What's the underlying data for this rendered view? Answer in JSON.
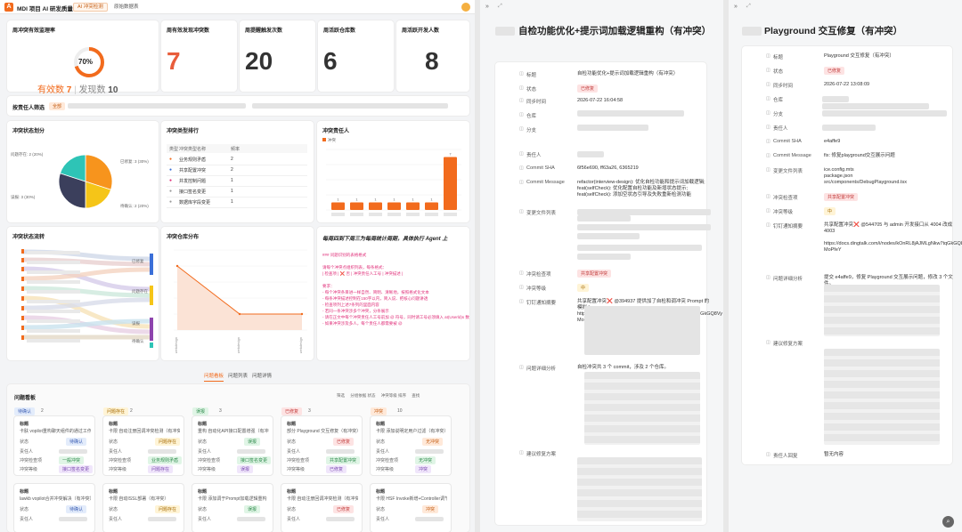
{
  "app": {
    "title": "MDI 项目 AI 研发质量",
    "tab_active": "AI 冲突检测",
    "tab_other": "原始数据表"
  },
  "kpis": [
    {
      "label": "周冲突有效监理率",
      "gauge": "70%",
      "valid_label": "有效数",
      "valid": "7",
      "found_label": "发现数",
      "found": "10",
      "rate": 0.7
    },
    {
      "label": "周有效发现冲突数",
      "value": "7",
      "color": "#e85d3b"
    },
    {
      "label": "周提醒触发次数",
      "value": "20",
      "color": "#333333"
    },
    {
      "label": "周活跃仓库数",
      "value": "6",
      "color": "#333333"
    },
    {
      "label": "周活跃开发人数",
      "value": "8",
      "color": "#333333"
    }
  ],
  "filter": {
    "label": "按责任人筛选",
    "active": "全部"
  },
  "pie": {
    "title": "冲突状态划分",
    "slices": [
      {
        "name": "已修复: 3 (30%)",
        "value": 30,
        "color": "#f7941d"
      },
      {
        "name": "问题存在: 2 (20%)",
        "value": 20,
        "color": "#f5c518"
      },
      {
        "name": "误报: 3 (30%)",
        "value": 30,
        "color": "#3b3f5c"
      },
      {
        "name": "待确认: 2 (20%)",
        "value": 20,
        "color": "#2ec4b6"
      }
    ],
    "labels": {
      "tl": "问题存在: 2 (20%)",
      "tr": "已修复: 3 (30%)",
      "bl": "误报: 3 (30%)",
      "br": "待确认: 2 (20%)"
    }
  },
  "rank": {
    "title": "冲突类型排行",
    "col1": "类型",
    "col2": "冲突类型名称",
    "col3": "频率",
    "rows": [
      {
        "icon": "●",
        "name": "业务规则矛盾",
        "count": "2"
      },
      {
        "icon": "●",
        "name": "共享配置冲突",
        "count": "2"
      },
      {
        "icon": "●",
        "name": "并发控制问题",
        "count": "1"
      },
      {
        "icon": "●",
        "name": "接口签名变更",
        "count": "1"
      },
      {
        "icon": "●",
        "name": "数据库字段变更",
        "count": "1"
      }
    ]
  },
  "people": {
    "title": "冲突责任人",
    "legend": "冲突",
    "values": [
      1,
      1,
      1,
      1,
      1,
      1,
      7
    ],
    "ymax": 8
  },
  "flow": {
    "title": "冲突状态流转",
    "targets": [
      "已修复",
      "问题存在",
      "误报",
      "待确认"
    ]
  },
  "repo": {
    "title": "冲突仓库分布",
    "values": [
      4,
      1,
      1
    ],
    "xlabels": [
      "webdesign",
      "webdesign",
      "webdesign"
    ]
  },
  "bot": {
    "banner": "每周四到下周三为每周统计周期，具体执行 Agent 上",
    "lines": [
      "### 问题识别的表格格式",
      "",
      "请每个冲突点组织列表，每条格式：",
      "| 检查项 | ❌ 否 | 冲突责任人工号 | 冲突描述 |",
      "",
      "要求：",
      "- 每个冲突条目进一样自然、简明、清晰地，按照格式化文本",
      "- 每条冲突描述控制在150字以内，简入说、把核心问题讲透",
      "- 检查项列上述7条列的里面内容",
      "- 若同一条冲突涉多个冲突，分条展示",
      "- 请在正文中每个冲突责任人工号前加 @ 符号，同时请工号必须填入 at(Userld)s 数组",
      "- 如果冲突涉及多人，每个责任人都需要被 @"
    ]
  },
  "tabs": {
    "items": [
      "问题看板",
      "问题列表",
      "问题详情"
    ],
    "active": 0
  },
  "board": {
    "title": "问题看板",
    "tools": [
      "筛选",
      "分组依据 状态",
      "冲突等级 排序",
      "查找"
    ],
    "columns": [
      {
        "name": "待确认",
        "count": "2",
        "cls": "tg-b"
      },
      {
        "name": "问题存在",
        "count": "2",
        "cls": "tg-y"
      },
      {
        "name": "误报",
        "count": "3",
        "cls": "tg-g"
      },
      {
        "name": "已修复",
        "count": "3",
        "cls": "tg-r"
      },
      {
        "name": "冲突",
        "count": "10",
        "cls": "tg-o"
      }
    ],
    "cards": [
      {
        "title": "卡肤 vopilot重构聊天组件的通过工作",
        "status": "待确认",
        "cls": "tg-b",
        "level": "一般冲突",
        "tag2": "接口签名变更"
      },
      {
        "title": "卡限 自动注册回调冲突检测（有冲突）",
        "status": "问题存在",
        "cls": "tg-y",
        "level": "业务规则矛盾",
        "tag2": "问题存在"
      },
      {
        "title": "重构 自动化API接口配置增强（有冲突）",
        "status": "误报",
        "cls": "tg-g",
        "level": "接口签名变更",
        "tag2": "误报"
      },
      {
        "title": "部分 Playground 交互修复（有冲突）",
        "status": "已修复",
        "cls": "tg-r",
        "level": "共享配置冲突",
        "tag2": "已修复"
      },
      {
        "title": "卡限 添加说明定用户过滤（有冲突）",
        "status": "无冲突",
        "cls": "tg-o",
        "level": "无冲突",
        "tag2": "冲突"
      }
    ],
    "card_labels": [
      "标题",
      "状态",
      "责任人",
      "冲突检查项",
      "冲突等级"
    ],
    "row2": [
      {
        "title": "lawkb vopilot合并冲突解决（有冲突）",
        "status": "待确认"
      },
      {
        "title": "卡限 自动ISSL部署（有冲突）",
        "status": "问题存在"
      },
      {
        "title": "卡限 添加调于Prompt加载逻辑重构（有冲突）",
        "status": "误报"
      },
      {
        "title": "卡限 自动注册回调冲突检测（有冲突）",
        "status": "已修复"
      },
      {
        "title": "卡限 HSF Invoke新增+Controller调节（有冲突）",
        "status": "冲突"
      }
    ]
  },
  "panel1": {
    "title": "自检功能优化+提示词加载逻辑重构（有冲突）",
    "fields": [
      {
        "k": "标题",
        "v": "自检功能优化+提示词加载逻辑重构（有冲突）"
      },
      {
        "k": "状态",
        "v": "已修复",
        "tag": "tg-r"
      },
      {
        "k": "同步时间",
        "v": "2026-07-22        16:04:58"
      },
      {
        "k": "仓库",
        "v": ""
      },
      {
        "k": "分支",
        "v": ""
      },
      {
        "k": "责任人",
        "v": ""
      },
      {
        "k": "Commit SHA",
        "v": "6f56e690, ff63a26, 6365219"
      },
      {
        "k": "Commit Message",
        "v": "refactor(interview-design): 优化自检功能和提示词加载逻辑;\nfeat(selfCheck): 优化配置自检功能及新增状态提示;\nfeat(selfCheck): 添加空状态引导及失败重新检测功能"
      },
      {
        "k": "变更文件列表",
        "v": ""
      },
      {
        "k": "冲突检查项",
        "v": "共享配置冲突",
        "tag": "tg-r"
      },
      {
        "k": "冲突等级",
        "v": "中",
        "tag": "tg-y"
      },
      {
        "k": "钉钉通知摘要",
        "v": "共享配置冲突❌ @394937 提供加了自检和调冲突 Prompt 的模拟 key\nhttps://docs.dingtalk.com/i/nodes/kOnRL8jAJMLgNkw7tqGkGQ8Vy\nMoPfeY"
      },
      {
        "k": "问题详细分析",
        "v": "自检冲突共 3 个 commit，涉及 2 个仓库。"
      },
      {
        "k": "建议修复方案",
        "v": ""
      }
    ]
  },
  "panel2": {
    "title": "Playground 交互修复（有冲突）",
    "fields": [
      {
        "k": "标题",
        "v": "Playground 交互修复（有冲突）"
      },
      {
        "k": "状态",
        "v": "已修复",
        "tag": "tg-r"
      },
      {
        "k": "同步时间",
        "v": "2026-07-22        13:08:09"
      },
      {
        "k": "仓库",
        "v": ""
      },
      {
        "k": "分支",
        "v": ""
      },
      {
        "k": "责任人",
        "v": ""
      },
      {
        "k": "Commit SHA",
        "v": "e4affe9"
      },
      {
        "k": "Commit Message",
        "v": "fix: 修复playground交互展示问题"
      },
      {
        "k": "变更文件列表",
        "v": "ice.config.mts\npackage.json\nsrc/components/DebugPlayground.tsx"
      },
      {
        "k": "冲突检查项",
        "v": "共享配置冲突",
        "tag": "tg-r"
      },
      {
        "k": "冲突等级",
        "v": "中",
        "tag": "tg-y"
      },
      {
        "k": "钉钉通知摘要",
        "v": "共享配置冲突❌ @544705 与 admin 开发接口从 4004 改成 4003\n\nhttps://docs.dingtalk.com/i/nodes/kOnRL8jAJMLgNkw7tqGkGQ8Vy\nMoPfeY"
      },
      {
        "k": "问题详细分析",
        "v": "提交 e4affe9，修复 Playground 交互展示问题，修改 3 个文件。"
      },
      {
        "k": "建议修复方案",
        "v": ""
      },
      {
        "k": "责任人回复",
        "v": "暂无内容"
      }
    ]
  }
}
